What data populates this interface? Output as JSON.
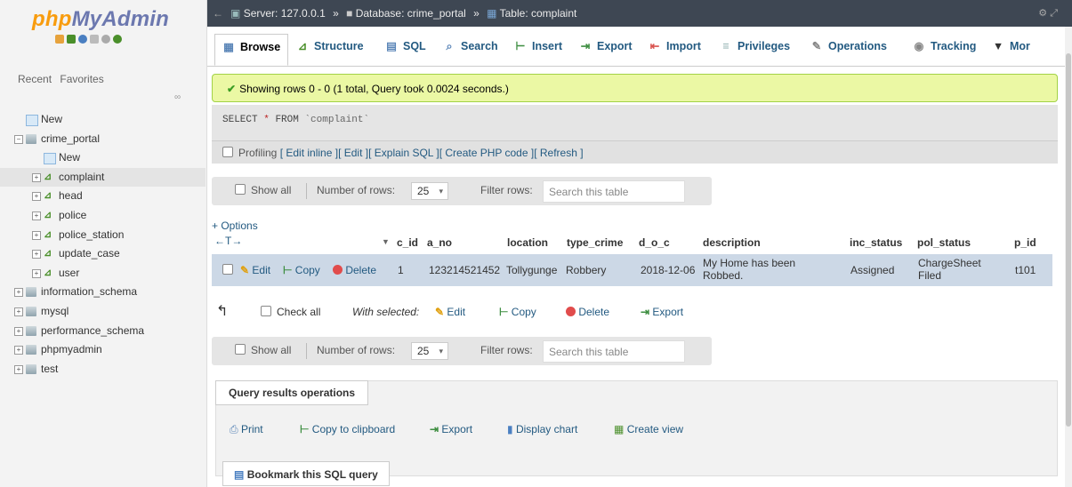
{
  "app": {
    "logo_php": "php",
    "logo_rest": "MyAdmin"
  },
  "nav": {
    "tabs": [
      "Recent",
      "Favorites"
    ],
    "tree": [
      {
        "label": "New",
        "type": "new",
        "indent": 0
      },
      {
        "label": "crime_portal",
        "type": "db",
        "indent": 0,
        "expanded": true
      },
      {
        "label": "New",
        "type": "new",
        "indent": 1
      },
      {
        "label": "complaint",
        "type": "table",
        "indent": 1,
        "selected": true
      },
      {
        "label": "head",
        "type": "table",
        "indent": 1
      },
      {
        "label": "police",
        "type": "table",
        "indent": 1
      },
      {
        "label": "police_station",
        "type": "table",
        "indent": 1
      },
      {
        "label": "update_case",
        "type": "table",
        "indent": 1
      },
      {
        "label": "user",
        "type": "table",
        "indent": 1
      },
      {
        "label": "information_schema",
        "type": "db",
        "indent": 0
      },
      {
        "label": "mysql",
        "type": "db",
        "indent": 0
      },
      {
        "label": "performance_schema",
        "type": "db",
        "indent": 0
      },
      {
        "label": "phpmyadmin",
        "type": "db",
        "indent": 0
      },
      {
        "label": "test",
        "type": "db",
        "indent": 0
      }
    ]
  },
  "breadcrumb": {
    "server": "Server: 127.0.0.1",
    "sep": "»",
    "database": "Database: crime_portal",
    "table": "Table: complaint"
  },
  "tabs": [
    {
      "label": "Browse",
      "icon": "▦",
      "color": "#5b86b8"
    },
    {
      "label": "Structure",
      "icon": "⊿",
      "color": "#4a8f2a"
    },
    {
      "label": "SQL",
      "icon": "▤",
      "color": "#5b86b8"
    },
    {
      "label": "Search",
      "icon": "⌕",
      "color": "#5b86b8"
    },
    {
      "label": "Insert",
      "icon": "⊢",
      "color": "#3e8e41"
    },
    {
      "label": "Export",
      "icon": "⇥",
      "color": "#3e8e41"
    },
    {
      "label": "Import",
      "icon": "⇤",
      "color": "#d9534f"
    },
    {
      "label": "Privileges",
      "icon": "≡",
      "color": "#8aa"
    },
    {
      "label": "Operations",
      "icon": "✎",
      "color": "#888"
    },
    {
      "label": "Tracking",
      "icon": "◉",
      "color": "#888"
    },
    {
      "label": "Mor",
      "icon": "▼",
      "color": "#333"
    }
  ],
  "success_message": "Showing rows 0 - 0 (1 total, Query took 0.0024 seconds.)",
  "sql": {
    "select": "SELECT",
    "star": "*",
    "from": "FROM",
    "table": "`complaint`"
  },
  "profiling": {
    "label": "Profiling",
    "links": [
      "[ Edit inline ]",
      "[ Edit ]",
      "[ Explain SQL ]",
      "[ Create PHP code ]",
      "[ Refresh ]"
    ]
  },
  "nav_form": {
    "show_all": "Show all",
    "number_of_rows": "Number of rows:",
    "rows_value": "25",
    "filter_rows": "Filter rows:",
    "search_placeholder": "Search this table"
  },
  "options_link": "+ Options",
  "columns": [
    "c_id",
    "a_no",
    "location",
    "type_crime",
    "d_o_c",
    "description",
    "inc_status",
    "pol_status",
    "p_id"
  ],
  "row_actions": {
    "edit": "Edit",
    "copy": "Copy",
    "delete": "Delete"
  },
  "rows": [
    {
      "c_id": "1",
      "a_no": "123214521452",
      "location": "Tollygunge",
      "type_crime": "Robbery",
      "d_o_c": "2018-12-06",
      "description_l1": "My Home has been",
      "description_l2": "Robbed.",
      "inc_status": "Assigned",
      "pol_status_l1": "ChargeSheet",
      "pol_status_l2": "Filed",
      "p_id": "t101"
    }
  ],
  "with_selected": {
    "check_all": "Check all",
    "label": "With selected:",
    "edit": "Edit",
    "copy": "Copy",
    "delete": "Delete",
    "export": "Export"
  },
  "query_results": {
    "title": "Query results operations",
    "print": "Print",
    "copy_clipboard": "Copy to clipboard",
    "export": "Export",
    "display_chart": "Display chart",
    "create_view": "Create view"
  },
  "bookmark": "Bookmark this SQL query"
}
